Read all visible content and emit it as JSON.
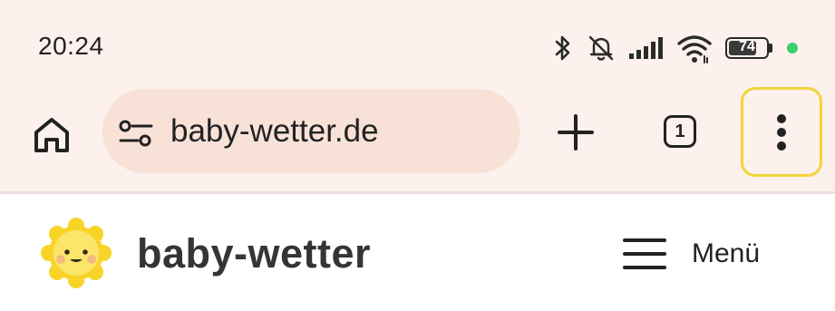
{
  "status_bar": {
    "time": "20:24",
    "icons": [
      "bluetooth-icon",
      "bell-off-icon",
      "signal-icon",
      "wifi-icon"
    ],
    "battery_percent": "74",
    "battery_level": 0.74,
    "indicator_color": "#3ccf6b"
  },
  "browser": {
    "url": "baby-wetter.de",
    "tab_count": "1",
    "icons": [
      "home-icon",
      "tune-icon",
      "plus-icon",
      "tabs-icon",
      "more-vert-icon"
    ],
    "highlight_color": "#f3d33a"
  },
  "site": {
    "title": "baby-wetter",
    "logo": "sun-face-logo",
    "menu_label": "Menü",
    "menu_icon": "hamburger-icon"
  }
}
